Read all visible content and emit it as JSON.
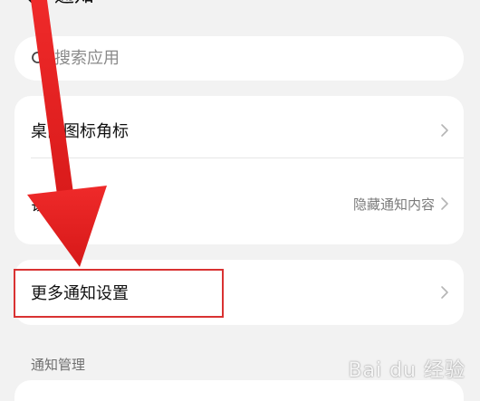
{
  "header": {
    "title": "通知",
    "back_icon": "back-arrow-icon"
  },
  "search": {
    "placeholder": "搜索应用",
    "value": ""
  },
  "settings": {
    "desktop_badge": {
      "label": "桌面图标角标"
    },
    "lock_screen": {
      "label": "锁屏通知",
      "value": "隐藏通知内容"
    },
    "more_settings": {
      "label": "更多通知设置"
    }
  },
  "section": {
    "notification_management": "通知管理"
  },
  "watermark": {
    "text": "Bai du 经验"
  },
  "colors": {
    "background": "#f2f2f2",
    "card": "#ffffff",
    "annotation_red": "#d93232"
  }
}
